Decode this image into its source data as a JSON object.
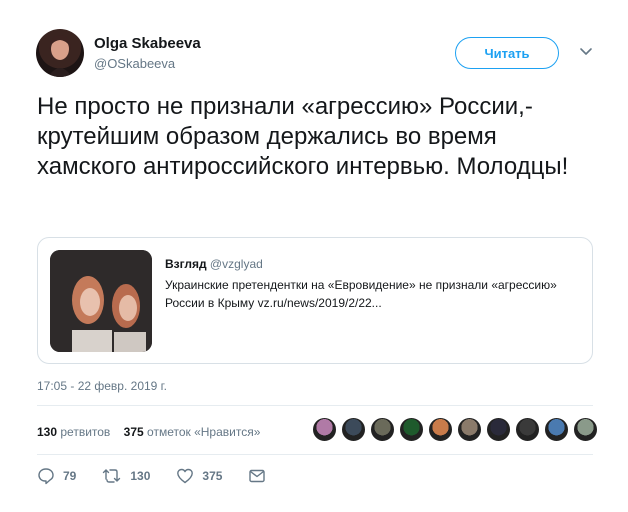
{
  "author": {
    "name": "Olga Skabeeva",
    "handle": "@OSkabeeva",
    "avatar_icon": "user-avatar"
  },
  "follow_button": "Читать",
  "tweet": {
    "text": "Не просто не признали «агрессию» России,- крутейшим образом держались во время хамского антироссийского интервью. Молодцы!"
  },
  "quoted_tweet": {
    "author_name": "Взгляд",
    "author_handle": "@vzglyad",
    "text": "Украинские претендентки на «Евровидение» не признали «агрессию» России в Крыму vz.ru/news/2019/2/22..."
  },
  "timestamp": "17:05 - 22 февр. 2019 г.",
  "stats": {
    "retweets_count": "130",
    "retweets_label": "ретвитов",
    "likes_count": "375",
    "likes_label": "отметок «Нравится»"
  },
  "facepile_colors": [
    "#b07aa6",
    "#3c4a5a",
    "#6a6a5a",
    "#1e5a2c",
    "#c97b4a",
    "#8a7a6a",
    "#2a2a3a",
    "#3a3a3a",
    "#4a7ab0",
    "#8a9a8a"
  ],
  "actions": {
    "replies": "79",
    "retweets": "130",
    "likes": "375"
  },
  "colors": {
    "accent": "#1da1f2",
    "secondary_text": "#657786",
    "border": "#e6ecf0"
  }
}
